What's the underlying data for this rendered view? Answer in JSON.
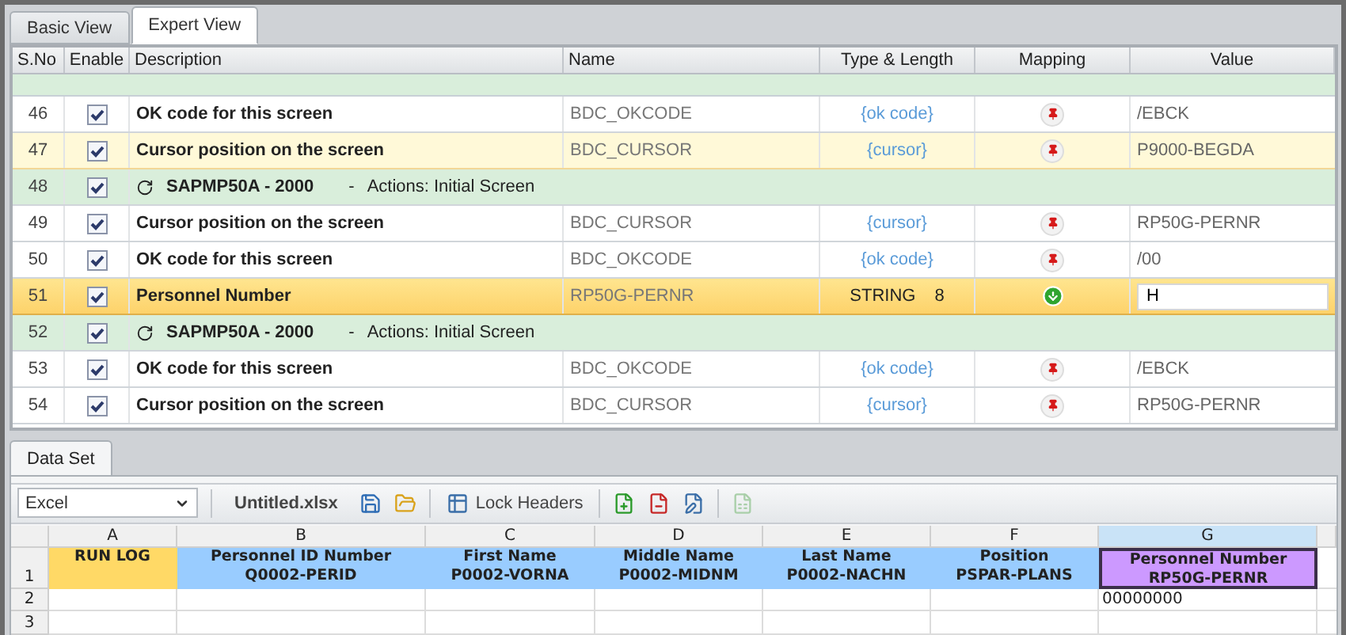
{
  "tabs": [
    {
      "label": "Basic View",
      "selected": false
    },
    {
      "label": "Expert View",
      "selected": true
    }
  ],
  "grid": {
    "columns": [
      "S.No",
      "Enable",
      "Description",
      "Name",
      "Type & Length",
      "Mapping",
      "Value"
    ],
    "rows": [
      {
        "sno": "46",
        "kind": "step",
        "enabled": true,
        "description": "OK code for this screen",
        "name": "BDC_OKCODE",
        "type": "{ok code}",
        "placeholder_type": true,
        "imported": false,
        "value": "/EBCK",
        "selected": false,
        "hovered": false
      },
      {
        "sno": "47",
        "kind": "step",
        "enabled": true,
        "description": "Cursor position on the screen",
        "name": "BDC_CURSOR",
        "type": "{cursor}",
        "placeholder_type": true,
        "imported": false,
        "value": "P9000-BEGDA",
        "selected": false,
        "hovered": true
      },
      {
        "sno": "48",
        "kind": "screen",
        "enabled": true,
        "program": "SAPMP50A - 2000",
        "separator": "-",
        "action": "Actions: Initial Screen",
        "selected": false,
        "hovered": false
      },
      {
        "sno": "49",
        "kind": "step",
        "enabled": true,
        "description": "Cursor position on the screen",
        "name": "BDC_CURSOR",
        "type": "{cursor}",
        "placeholder_type": true,
        "imported": false,
        "value": "RP50G-PERNR",
        "selected": false,
        "hovered": false
      },
      {
        "sno": "50",
        "kind": "step",
        "enabled": true,
        "description": "OK code for this screen",
        "name": "BDC_OKCODE",
        "type": "{ok code}",
        "placeholder_type": true,
        "imported": false,
        "value": "/00",
        "selected": false,
        "hovered": false
      },
      {
        "sno": "51",
        "kind": "step",
        "enabled": true,
        "description": "Personnel Number",
        "name": "RP50G-PERNR",
        "type": "STRING",
        "length": "8",
        "placeholder_type": false,
        "imported": true,
        "value": "H",
        "editing": true,
        "selected": true,
        "hovered": false
      },
      {
        "sno": "52",
        "kind": "screen",
        "enabled": true,
        "program": "SAPMP50A - 2000",
        "separator": "-",
        "action": "Actions: Initial Screen",
        "selected": false,
        "hovered": false
      },
      {
        "sno": "53",
        "kind": "step",
        "enabled": true,
        "description": "OK code for this screen",
        "name": "BDC_OKCODE",
        "type": "{ok code}",
        "placeholder_type": true,
        "imported": false,
        "value": "/EBCK",
        "selected": false,
        "hovered": false
      },
      {
        "sno": "54",
        "kind": "step",
        "enabled": true,
        "description": "Cursor position on the screen",
        "name": "BDC_CURSOR",
        "type": "{cursor}",
        "placeholder_type": true,
        "imported": false,
        "value": "RP50G-PERNR",
        "selected": false,
        "hovered": false
      }
    ]
  },
  "bottom_tabs": [
    {
      "label": "Data Set",
      "selected": true
    }
  ],
  "toolbar": {
    "format": "Excel",
    "file": "Untitled.xlsx",
    "lock_headers": "Lock Headers"
  },
  "sheet": {
    "columns": [
      {
        "letter": "A",
        "title": "RUN LOG",
        "color": "#ffd966",
        "selected": false
      },
      {
        "letter": "B",
        "title": "Personnel ID Number",
        "field": "Q0002-PERID",
        "color": "#99ccff",
        "selected": false
      },
      {
        "letter": "C",
        "title": "First Name",
        "field": "P0002-VORNA",
        "color": "#99ccff",
        "selected": false
      },
      {
        "letter": "D",
        "title": "Middle Name",
        "field": "P0002-MIDNM",
        "color": "#99ccff",
        "selected": false
      },
      {
        "letter": "E",
        "title": "Last Name",
        "field": "P0002-NACHN",
        "color": "#99ccff",
        "selected": false
      },
      {
        "letter": "F",
        "title": "Position",
        "field": "PSPAR-PLANS",
        "color": "#99ccff",
        "selected": false
      },
      {
        "letter": "G",
        "title": "Personnel Number",
        "field": "RP50G-PERNR",
        "color": "#cc99ff",
        "selected": true,
        "values": [
          "00000000"
        ]
      }
    ],
    "header_row": "1",
    "row_numbers": [
      "2",
      "3"
    ]
  }
}
